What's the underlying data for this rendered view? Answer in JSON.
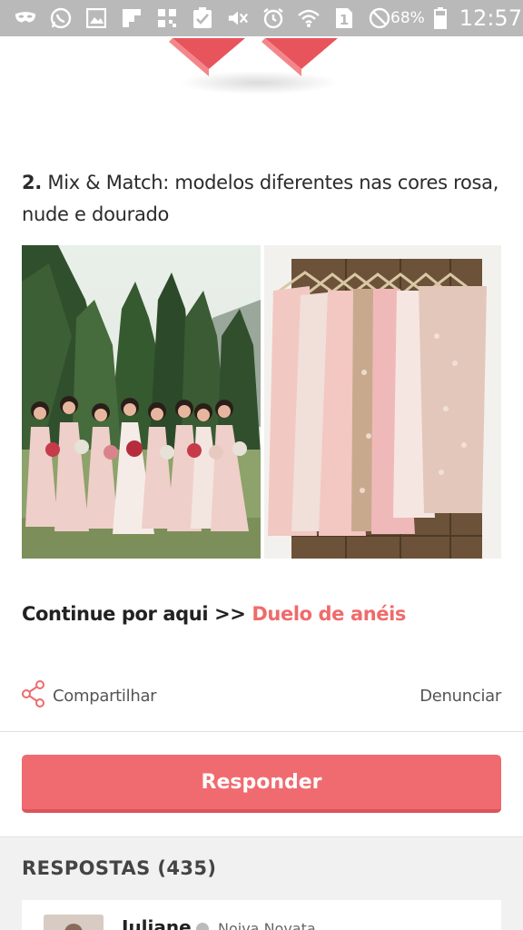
{
  "status_bar": {
    "battery_percent": "68%",
    "time": "12:57",
    "icons": [
      "mask-icon",
      "whatsapp-icon",
      "gallery-icon",
      "flipboard-icon",
      "qr-icon",
      "clipboard-check-icon",
      "mute-icon",
      "alarm-icon",
      "wifi-icon",
      "sim1-icon",
      "no-disturb-icon",
      "battery-icon"
    ]
  },
  "article": {
    "item_number": "2.",
    "item_text": "Mix & Match: modelos diferentes nas cores rosa, nude e dourado",
    "continue_prefix": "Continue por aqui >>",
    "continue_link": "Duelo de anéis"
  },
  "actions": {
    "share_label": "Compartilhar",
    "report_label": "Denunciar"
  },
  "reply_button": {
    "label": "Responder"
  },
  "answers": {
    "title": "RESPOSTAS (435)",
    "first": {
      "user_name": "Juliane",
      "user_role": "Noiva Novata"
    }
  },
  "colors": {
    "accent": "#f06b6f",
    "link": "#ef6b6b",
    "status_bar": "#b9b9b9"
  }
}
